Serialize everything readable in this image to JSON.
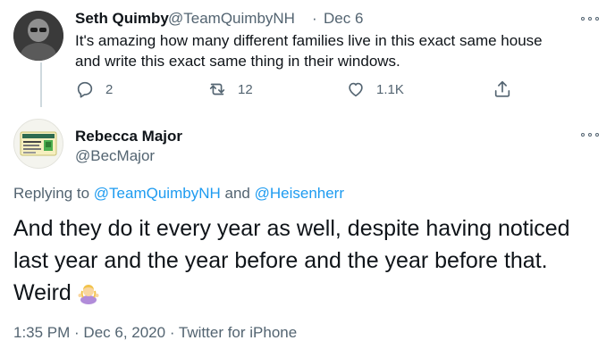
{
  "parent_tweet": {
    "author_name": "Seth Quimby",
    "author_handle": "@TeamQuimbyNH",
    "separator": "·",
    "date": "Dec 6",
    "text_line1": "It's amazing how many different families live in this exact same house",
    "text_line2": "and write this exact same thing in their windows.",
    "actions": {
      "reply_count": "2",
      "retweet_count": "12",
      "like_count": "1.1K"
    }
  },
  "main_tweet": {
    "author_name": "Rebecca Major",
    "author_handle": "@BecMajor",
    "replying_prefix": "Replying to",
    "replying_to_1": "@TeamQuimbyNH",
    "replying_and": "and",
    "replying_to_2": "@Heisenherr",
    "text_line1": "And they do it every year as well, despite having noticed",
    "text_line2": "last year and the year before and the year before that.",
    "text_line3": "Weird",
    "timestamp": "1:35 PM · Dec 6, 2020",
    "meta_separator": "·",
    "source": "Twitter for iPhone"
  },
  "icons": {
    "reply": "reply-icon",
    "retweet": "retweet-icon",
    "like": "heart-icon",
    "share": "share-icon",
    "more": "more-icon",
    "emoji": "woman-shrugging-emoji"
  },
  "colors": {
    "text": "#0f1419",
    "secondary": "#536471",
    "link": "#1d9bf0",
    "thread_line": "#cfd9de"
  }
}
